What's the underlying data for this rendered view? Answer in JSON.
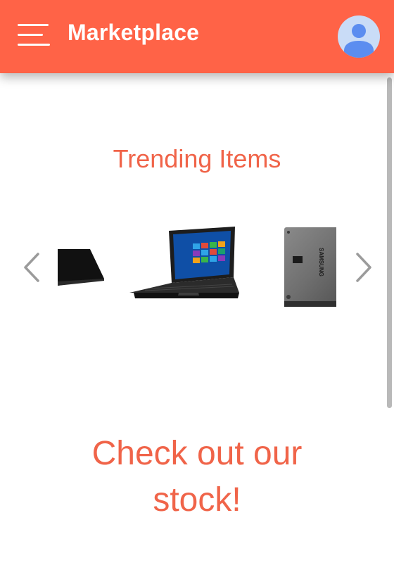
{
  "header": {
    "title": "Marketplace",
    "icons": {
      "menu": "hamburger-menu-icon",
      "profile": "user-avatar-icon"
    }
  },
  "trending": {
    "heading": "Trending Items",
    "items": [
      {
        "name": "keyboard",
        "icon": "rgb-keyboard-image"
      },
      {
        "name": "laptop",
        "icon": "laptop-image"
      },
      {
        "name": "ssd",
        "icon": "samsung-ssd-image",
        "brand": "SAMSUNG"
      }
    ],
    "controls": {
      "prev": "chevron-left-icon",
      "next": "chevron-right-icon"
    }
  },
  "cta": {
    "line1": "Check out our",
    "line2": "stock!"
  },
  "colors": {
    "brand": "#ff6347",
    "accent_text": "#f06449",
    "avatar_bg": "#c9dcf7",
    "avatar_fg": "#5b8df0"
  }
}
